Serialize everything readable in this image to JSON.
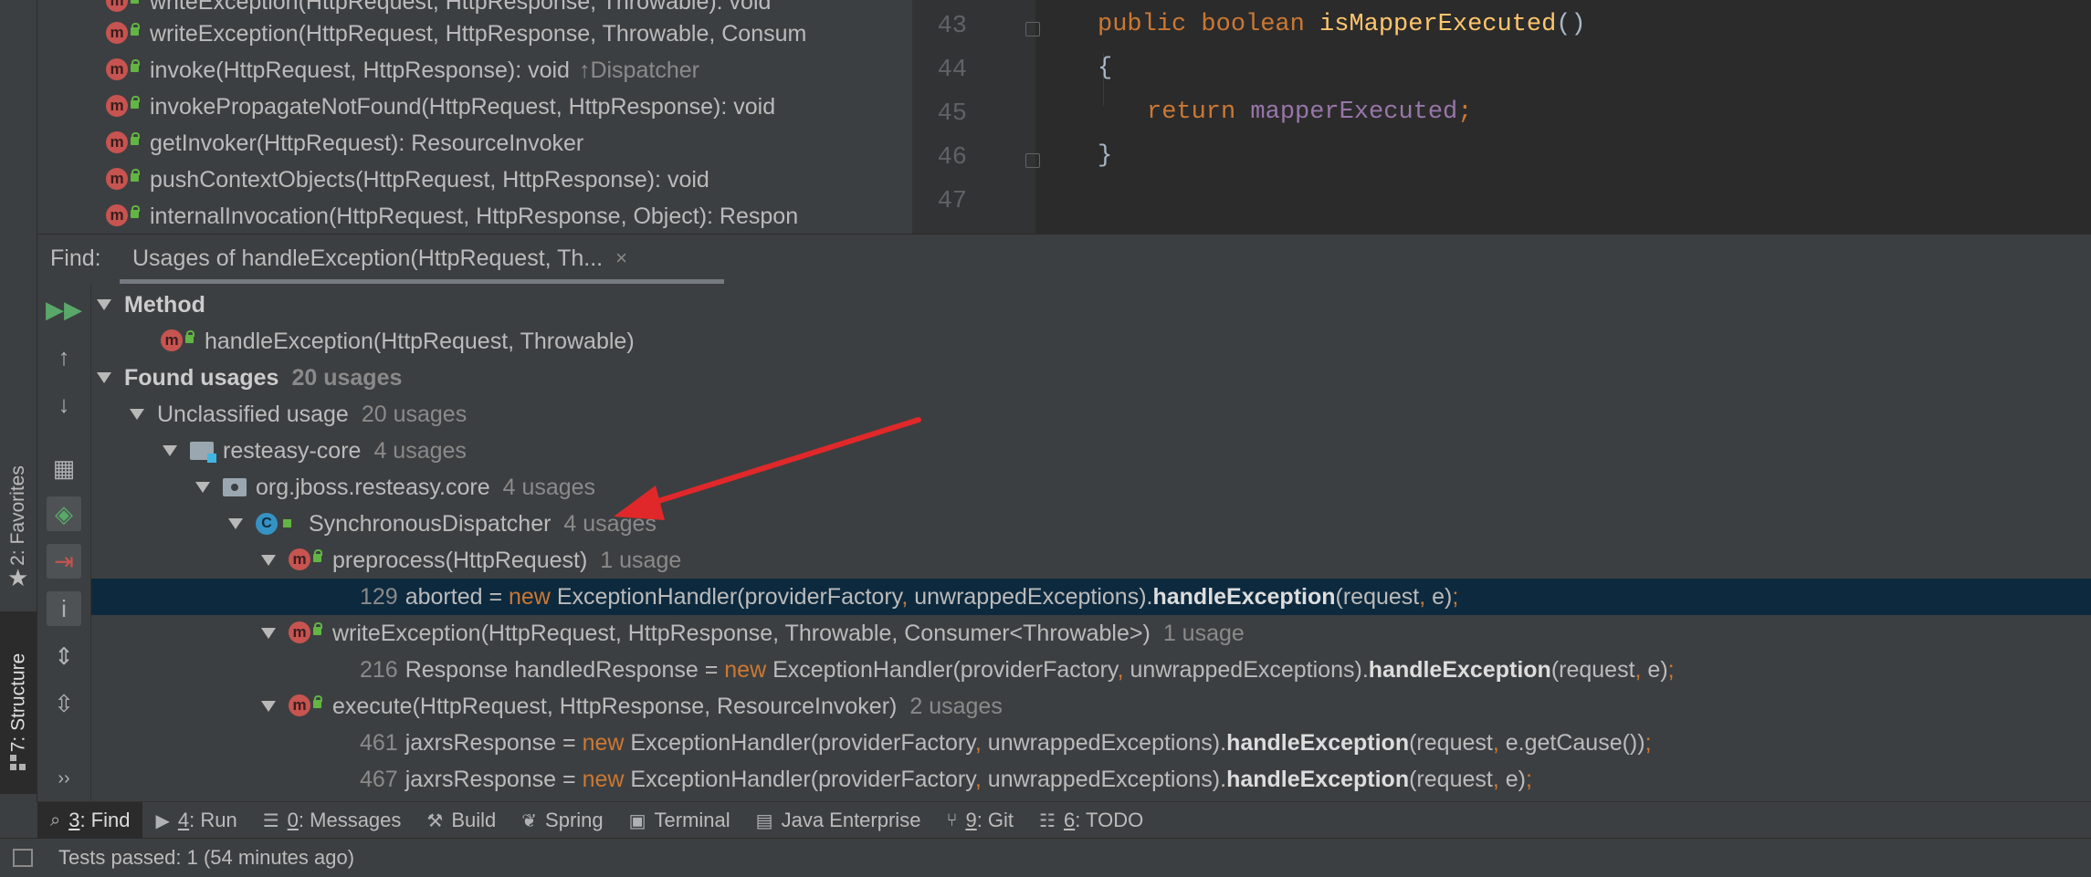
{
  "sidebar": {
    "favorites_label": "2: Favorites",
    "structure_label": "7: Structure"
  },
  "structure": {
    "items": [
      {
        "name": "writeException(HttpRequest, HttpResponse, Throwable): void",
        "suffix": ""
      },
      {
        "name": "writeException(HttpRequest, HttpResponse, Throwable, Consum",
        "suffix": ""
      },
      {
        "name": "invoke(HttpRequest, HttpResponse): void",
        "suffix": "↑Dispatcher"
      },
      {
        "name": "invokePropagateNotFound(HttpRequest, HttpResponse): void",
        "suffix": ""
      },
      {
        "name": "getInvoker(HttpRequest): ResourceInvoker",
        "suffix": ""
      },
      {
        "name": "pushContextObjects(HttpRequest, HttpResponse): void",
        "suffix": ""
      },
      {
        "name": "internalInvocation(HttpRequest, HttpResponse, Object): Respon",
        "suffix": ""
      }
    ]
  },
  "editor": {
    "line_numbers": [
      "43",
      "44",
      "45",
      "46",
      "47"
    ],
    "line43": {
      "kw1": "public",
      "kw2": "boolean",
      "fn": "isMapperExecuted",
      "rest": "()"
    },
    "line44": "{",
    "line45": {
      "kw": "return",
      "field": "mapperExecuted",
      "semi": ";"
    },
    "line46": "}"
  },
  "find": {
    "label": "Find:",
    "tab_title": "Usages of handleException(HttpRequest, Th...",
    "close_glyph": "×"
  },
  "results": {
    "method_header": "Method",
    "method_signature": "handleException(HttpRequest, Throwable)",
    "found_usages": "Found usages",
    "found_count": "20 usages",
    "unclassified": "Unclassified usage",
    "unclassified_count": "20 usages",
    "module": "resteasy-core",
    "module_count": "4 usages",
    "package": "org.jboss.resteasy.core",
    "package_count": "4 usages",
    "class": "SynchronousDispatcher",
    "class_count": "4 usages",
    "methods": [
      {
        "name": "preprocess(HttpRequest)",
        "count": "1 usage",
        "lines": [
          {
            "num": "129",
            "pre": "aborted = ",
            "new": "new",
            "mid": " ExceptionHandler(providerFactory",
            "comma": ",",
            "mid2": " unwrappedExceptions).",
            "call": "handleException",
            "args": "(request",
            "comma2": ",",
            "args2": " e)",
            "end": ";"
          }
        ]
      },
      {
        "name": "writeException(HttpRequest, HttpResponse, Throwable, Consumer<Throwable>)",
        "count": "1 usage",
        "lines": [
          {
            "num": "216",
            "pre": "Response handledResponse = ",
            "new": "new",
            "mid": " ExceptionHandler(providerFactory",
            "comma": ",",
            "mid2": " unwrappedExceptions).",
            "call": "handleException",
            "args": "(request",
            "comma2": ",",
            "args2": " e)",
            "end": ";"
          }
        ]
      },
      {
        "name": "execute(HttpRequest, HttpResponse, ResourceInvoker)",
        "count": "2 usages",
        "lines": [
          {
            "num": "461",
            "pre": "jaxrsResponse = ",
            "new": "new",
            "mid": " ExceptionHandler(providerFactory",
            "comma": ",",
            "mid2": " unwrappedExceptions).",
            "call": "handleException",
            "args": "(request",
            "comma2": ",",
            "args2": " e.getCause())",
            "end": ";"
          },
          {
            "num": "467",
            "pre": "jaxrsResponse = ",
            "new": "new",
            "mid": " ExceptionHandler(providerFactory",
            "comma": ",",
            "mid2": " unwrappedExceptions).",
            "call": "handleException",
            "args": "(request",
            "comma2": ",",
            "args2": " e)",
            "end": ";"
          }
        ]
      }
    ]
  },
  "toolwindows": [
    {
      "key": "3",
      "label": ": Find",
      "icon": "search-icon",
      "active": true
    },
    {
      "key": "4",
      "label": ": Run",
      "icon": "run-icon",
      "active": false
    },
    {
      "key": "0",
      "label": ": Messages",
      "icon": "messages-icon",
      "active": false
    },
    {
      "key": "",
      "label": "Build",
      "icon": "build-icon",
      "active": false
    },
    {
      "key": "",
      "label": "Spring",
      "icon": "spring-icon",
      "active": false
    },
    {
      "key": "",
      "label": "Terminal",
      "icon": "terminal-icon",
      "active": false
    },
    {
      "key": "",
      "label": "Java Enterprise",
      "icon": "java-enterprise-icon",
      "active": false
    },
    {
      "key": "9",
      "label": ": Git",
      "icon": "git-icon",
      "active": false
    },
    {
      "key": "6",
      "label": ": TODO",
      "icon": "todo-icon",
      "active": false
    }
  ],
  "status": {
    "text": "Tests passed: 1 (54 minutes ago)"
  },
  "colors": {
    "selection": "#0d293e",
    "keyword": "#cc7832",
    "method_decl": "#ffc66d",
    "field": "#9876aa",
    "annotation_arrow": "#e0282a"
  }
}
